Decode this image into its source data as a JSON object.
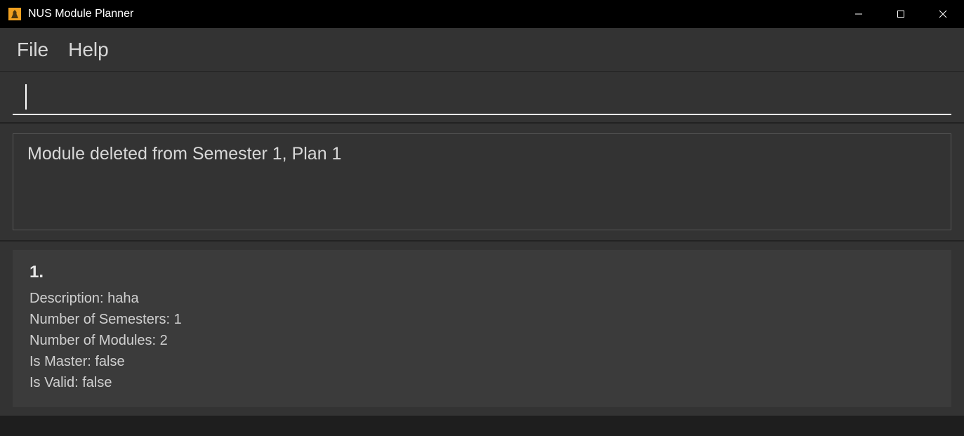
{
  "window": {
    "title": "NUS Module Planner"
  },
  "menu": {
    "file": "File",
    "help": "Help"
  },
  "command": {
    "value": ""
  },
  "message": {
    "text": "Module deleted from Semester 1, Plan 1"
  },
  "plan": {
    "index": "1.",
    "description_label": "Description: ",
    "description_value": "haha",
    "semesters_label": "Number of Semesters: ",
    "semesters_value": "1",
    "modules_label": "Number of Modules: ",
    "modules_value": "2",
    "master_label": "Is Master: ",
    "master_value": "false",
    "valid_label": "Is Valid: ",
    "valid_value": "false"
  }
}
